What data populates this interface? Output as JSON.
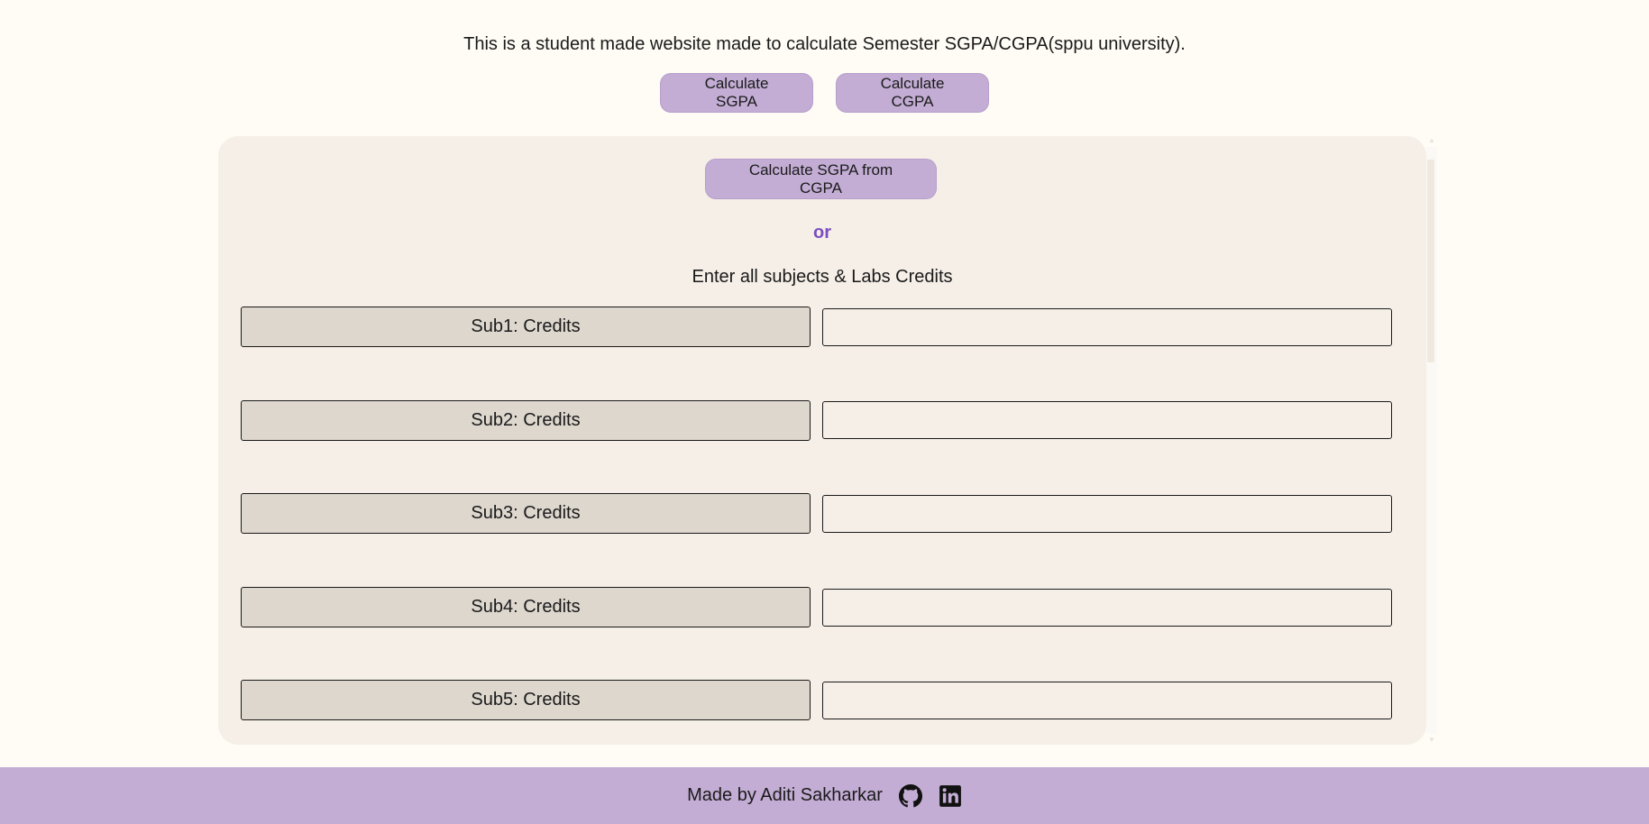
{
  "intro_text": "This is a student made website made to calculate Semester SGPA/CGPA(sppu university).",
  "nav": {
    "sgpa_label": "Calculate SGPA",
    "cgpa_label": "Calculate CGPA"
  },
  "calculator": {
    "sgpa_from_cgpa_label": "Calculate SGPA from CGPA",
    "or_text": "or",
    "heading": "Enter all subjects & Labs Credits",
    "rows": [
      {
        "label": "Sub1: Credits",
        "value": ""
      },
      {
        "label": "Sub2: Credits",
        "value": ""
      },
      {
        "label": "Sub3: Credits",
        "value": ""
      },
      {
        "label": "Sub4: Credits",
        "value": ""
      },
      {
        "label": "Sub5: Credits",
        "value": ""
      }
    ]
  },
  "footer": {
    "text": "Made by Aditi Sakharkar",
    "icons": [
      "github-icon",
      "linkedin-icon"
    ]
  },
  "colors": {
    "page_bg": "#fffcf5",
    "accent": "#c3add4",
    "card_bg": "#f5efe7",
    "label_bg": "#ddd7ce",
    "or_color": "#7b4fbf"
  }
}
